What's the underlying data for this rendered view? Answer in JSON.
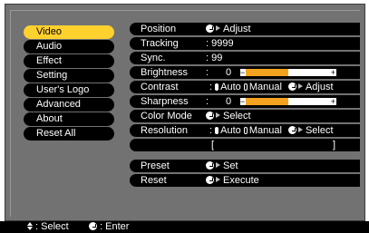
{
  "menu": [
    {
      "label": "Video",
      "active": true
    },
    {
      "label": "Audio"
    },
    {
      "label": "Effect"
    },
    {
      "label": "Setting"
    },
    {
      "label": "User's Logo"
    },
    {
      "label": "Advanced"
    },
    {
      "label": "About"
    },
    {
      "label": "Reset All"
    }
  ],
  "video": {
    "position": {
      "label": "Position",
      "action": "Adjust"
    },
    "tracking": {
      "label": "Tracking",
      "value": ": 9999"
    },
    "sync": {
      "label": "Sync.",
      "value": ":   99"
    },
    "brightness": {
      "label": "Brightness",
      "colon": ":",
      "value": "0",
      "level": 0.5
    },
    "contrast": {
      "label": "Contrast",
      "opt1": "Auto",
      "opt2": "Manual",
      "action": "Adjust",
      "selected": "Auto"
    },
    "sharpness": {
      "label": "Sharpness",
      "colon": ":",
      "value": "0",
      "level": 0.5
    },
    "color_mode": {
      "label": "Color Mode",
      "action": "Select"
    },
    "resolution": {
      "label": "Resolution",
      "opt1": "Auto",
      "opt2": "Manual",
      "action": "Select",
      "selected": "Auto"
    },
    "resolution_field": {
      "open": "[",
      "close": "]"
    },
    "preset": {
      "label": "Preset",
      "action": "Set"
    },
    "reset": {
      "label": "Reset",
      "action": "Execute"
    }
  },
  "footer": {
    "select_label": ": Select",
    "enter_label": ": Enter"
  },
  "colors": {
    "frame": "#727272",
    "highlight": "#ffd12e",
    "slider_fill": "#f4a320",
    "row_bg": "#000000"
  },
  "icons": {
    "enter": "enter-icon",
    "updown": "updown-icon",
    "arrow": "arrow-right-icon"
  }
}
